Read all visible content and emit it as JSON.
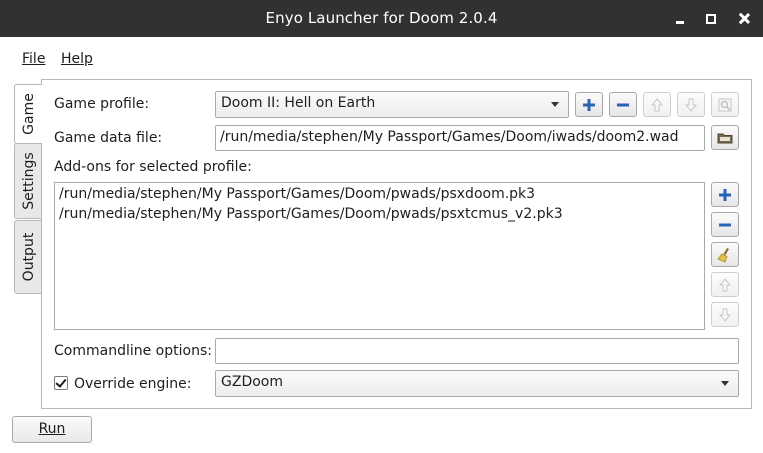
{
  "window": {
    "title": "Enyo Launcher for Doom 2.0.4"
  },
  "menu": {
    "file": "File",
    "help": "Help"
  },
  "tabs": [
    {
      "label": "Game",
      "active": true
    },
    {
      "label": "Settings",
      "active": false
    },
    {
      "label": "Output",
      "active": false
    }
  ],
  "game": {
    "profile_label": "Game profile:",
    "profile_value": "Doom II: Hell on Earth",
    "data_file_label": "Game data file:",
    "data_file_value": "/run/media/stephen/My Passport/Games/Doom/iwads/doom2.wad",
    "addons_label": "Add-ons for selected profile:",
    "addons": [
      "/run/media/stephen/My Passport/Games/Doom/pwads/psxdoom.pk3",
      "/run/media/stephen/My Passport/Games/Doom/pwads/psxtcmus_v2.pk3"
    ],
    "cmdline_label": "Commandline options:",
    "cmdline_value": "",
    "override_label": "Override engine:",
    "override_checked": true,
    "engine_value": "GZDoom"
  },
  "buttons": {
    "run": "Run"
  },
  "icons": {
    "profile_add": "plus-icon",
    "profile_remove": "minus-icon",
    "profile_up": "arrow-up-icon",
    "profile_down": "arrow-down-icon",
    "profile_rename": "rename-icon",
    "browse": "folder-icon",
    "addon_add": "plus-icon",
    "addon_remove": "minus-icon",
    "addon_clear": "broom-icon",
    "addon_up": "arrow-up-icon",
    "addon_down": "arrow-down-icon"
  },
  "colors": {
    "titlebar": "#313131",
    "accent_blue": "#2a62b8"
  }
}
